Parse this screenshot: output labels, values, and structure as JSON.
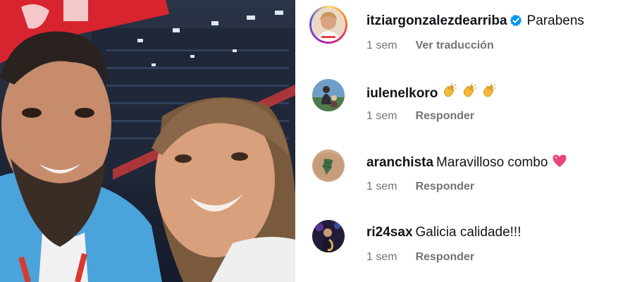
{
  "photo": {
    "alt_icon": "selfie-photo"
  },
  "comments": [
    {
      "username": "itziargonzalezdearriba",
      "verified": true,
      "text": "Parabens",
      "emoji": [],
      "time": "1 sem",
      "action": "Ver traducción",
      "avatar": "avatar-photo"
    },
    {
      "username": "iulenelkoro",
      "verified": false,
      "text": "",
      "emoji": [
        "clapping-hands-icon",
        "clapping-hands-icon",
        "clapping-hands-icon"
      ],
      "time": "1 sem",
      "action": "Responder",
      "avatar": "avatar-photo"
    },
    {
      "username": "aranchista",
      "verified": false,
      "text": "Maravilloso combo",
      "emoji": [
        "pink-heart-icon"
      ],
      "time": "1 sem",
      "action": "Responder",
      "avatar": "avatar-photo"
    },
    {
      "username": "ri24sax",
      "verified": false,
      "text": "Galicia calidade!!!",
      "emoji": [],
      "time": "1 sem",
      "action": "Responder",
      "avatar": "avatar-photo"
    }
  ],
  "colors": {
    "username": "#0f1419",
    "meta": "#737373",
    "verified": "#0095f6",
    "heart": "#e8457a"
  }
}
